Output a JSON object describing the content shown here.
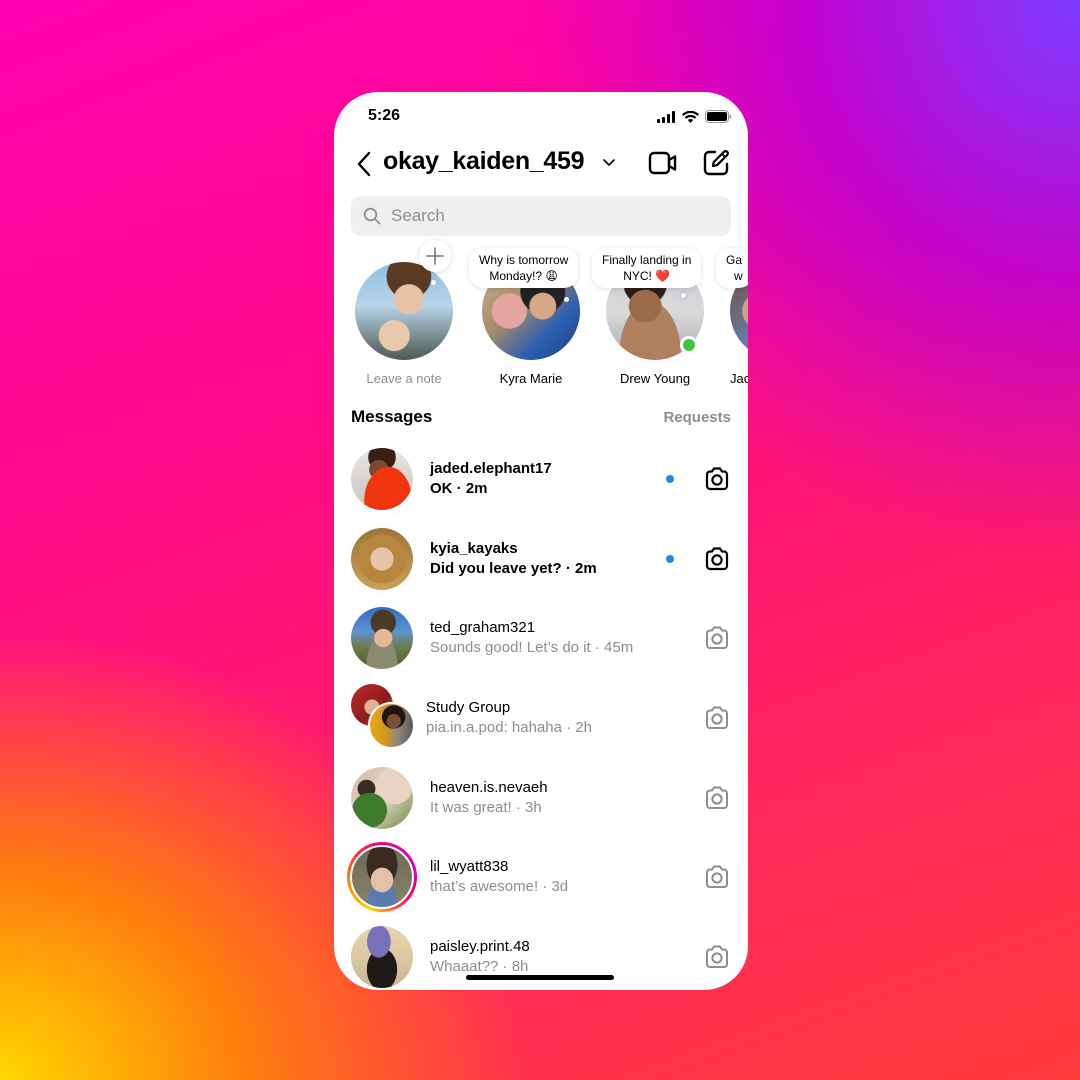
{
  "status_bar": {
    "time": "5:26"
  },
  "header": {
    "username": "okay_kaiden_459"
  },
  "search": {
    "placeholder": "Search"
  },
  "notes": [
    {
      "name": "Leave a note",
      "note": "",
      "own": true,
      "online": false
    },
    {
      "name": "Kyra Marie",
      "note_line1": "Why is tomorrow",
      "note_line2": "Monday!? 😩",
      "online": false
    },
    {
      "name": "Drew Young",
      "note_line1": "Finally landing in",
      "note_line2": "NYC! ❤️",
      "online": true
    },
    {
      "name": "Jac",
      "note_line1": "Ga",
      "note_line2": "w",
      "online": false
    }
  ],
  "messages": {
    "title": "Messages",
    "requests_label": "Requests",
    "threads": [
      {
        "name": "jaded.elephant17",
        "preview": "OK · 2m",
        "unread": true,
        "story_ring": false
      },
      {
        "name": "kyia_kayaks",
        "preview": "Did you leave yet? · 2m",
        "unread": true,
        "story_ring": false
      },
      {
        "name": "ted_graham321",
        "preview": "Sounds good! Let’s do it · 45m",
        "unread": false,
        "story_ring": false
      },
      {
        "name": "Study Group",
        "preview": "pia.in.a.pod: hahaha · 2h",
        "unread": false,
        "group": true
      },
      {
        "name": "heaven.is.nevaeh",
        "preview": "It was great! · 3h",
        "unread": false,
        "story_ring": false
      },
      {
        "name": "lil_wyatt838",
        "preview": "that’s awesome! · 3d",
        "unread": false,
        "story_ring": true
      },
      {
        "name": "paisley.print.48",
        "preview": "Whaaat?? · 8h",
        "unread": false,
        "story_ring": false
      }
    ]
  },
  "colors": {
    "unread_dot": "#1a8cf0",
    "online": "#3ec73e",
    "muted_text": "#8e8e8e",
    "search_bg": "#efefef"
  },
  "icons": {
    "back": "chevron-left-icon",
    "account_switch": "chevron-down-icon",
    "video": "video-camera-icon",
    "compose": "new-message-icon",
    "search": "search-icon",
    "thread_action": "camera-icon"
  }
}
